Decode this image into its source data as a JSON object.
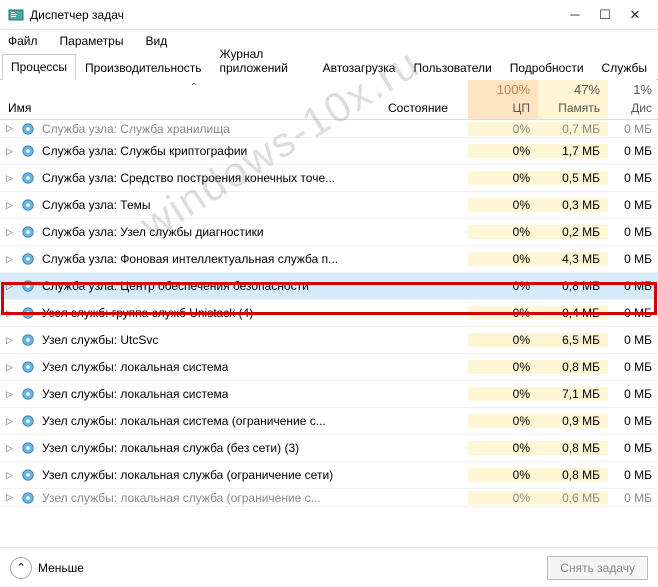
{
  "window": {
    "title": "Диспетчер задач"
  },
  "menu": {
    "file": "Файл",
    "options": "Параметры",
    "view": "Вид"
  },
  "tabs": {
    "processes": "Процессы",
    "performance": "Производительность",
    "apphistory": "Журнал приложений",
    "startup": "Автозагрузка",
    "users": "Пользователи",
    "details": "Подробности",
    "services": "Службы"
  },
  "columns": {
    "name": "Имя",
    "state": "Состояние",
    "cpu_pct": "100%",
    "cpu_label": "ЦП",
    "mem_pct": "47%",
    "mem_label": "Память",
    "disk_pct": "1%",
    "disk_label": "Дис"
  },
  "rows": [
    {
      "name": "Служба узла: Служба хранилища",
      "cpu": "0%",
      "mem": "0,7 МБ",
      "disk": "0 МБ",
      "cut": true
    },
    {
      "name": "Служба узла: Службы криптографии",
      "cpu": "0%",
      "mem": "1,7 МБ",
      "disk": "0 МБ"
    },
    {
      "name": "Служба узла: Средство построения конечных точе...",
      "cpu": "0%",
      "mem": "0,5 МБ",
      "disk": "0 МБ"
    },
    {
      "name": "Служба узла: Темы",
      "cpu": "0%",
      "mem": "0,3 МБ",
      "disk": "0 МБ"
    },
    {
      "name": "Служба узла: Узел службы диагностики",
      "cpu": "0%",
      "mem": "0,2 МБ",
      "disk": "0 МБ"
    },
    {
      "name": "Служба узла: Фоновая интеллектуальная служба п...",
      "cpu": "0%",
      "mem": "4,3 МБ",
      "disk": "0 МБ"
    },
    {
      "name": "Служба узла: Центр обеспечения безопасности",
      "cpu": "0%",
      "mem": "0,8 МБ",
      "disk": "0 МБ",
      "selected": true
    },
    {
      "name": "Узел служб: группа служб Unistack (4)",
      "cpu": "0%",
      "mem": "0,4 МБ",
      "disk": "0 МБ"
    },
    {
      "name": "Узел службы: UtcSvc",
      "cpu": "0%",
      "mem": "6,5 МБ",
      "disk": "0 МБ"
    },
    {
      "name": "Узел службы: локальная система",
      "cpu": "0%",
      "mem": "0,8 МБ",
      "disk": "0 МБ"
    },
    {
      "name": "Узел службы: локальная система",
      "cpu": "0%",
      "mem": "7,1 МБ",
      "disk": "0 МБ"
    },
    {
      "name": "Узел службы: локальная система (ограничение с...",
      "cpu": "0%",
      "mem": "0,9 МБ",
      "disk": "0 МБ"
    },
    {
      "name": "Узел службы: локальная служба (без сети) (3)",
      "cpu": "0%",
      "mem": "0,8 МБ",
      "disk": "0 МБ"
    },
    {
      "name": "Узел службы: локальная служба (ограничение сети)",
      "cpu": "0%",
      "mem": "0,8 МБ",
      "disk": "0 МБ"
    },
    {
      "name": "Узел службы: локальная служба (ограничение с...",
      "cpu": "0%",
      "mem": "0,6 МБ",
      "disk": "0 МБ",
      "cut": true
    }
  ],
  "footer": {
    "fewer": "Меньше",
    "endtask": "Снять задачу"
  },
  "watermark": "windows-10x.ru"
}
